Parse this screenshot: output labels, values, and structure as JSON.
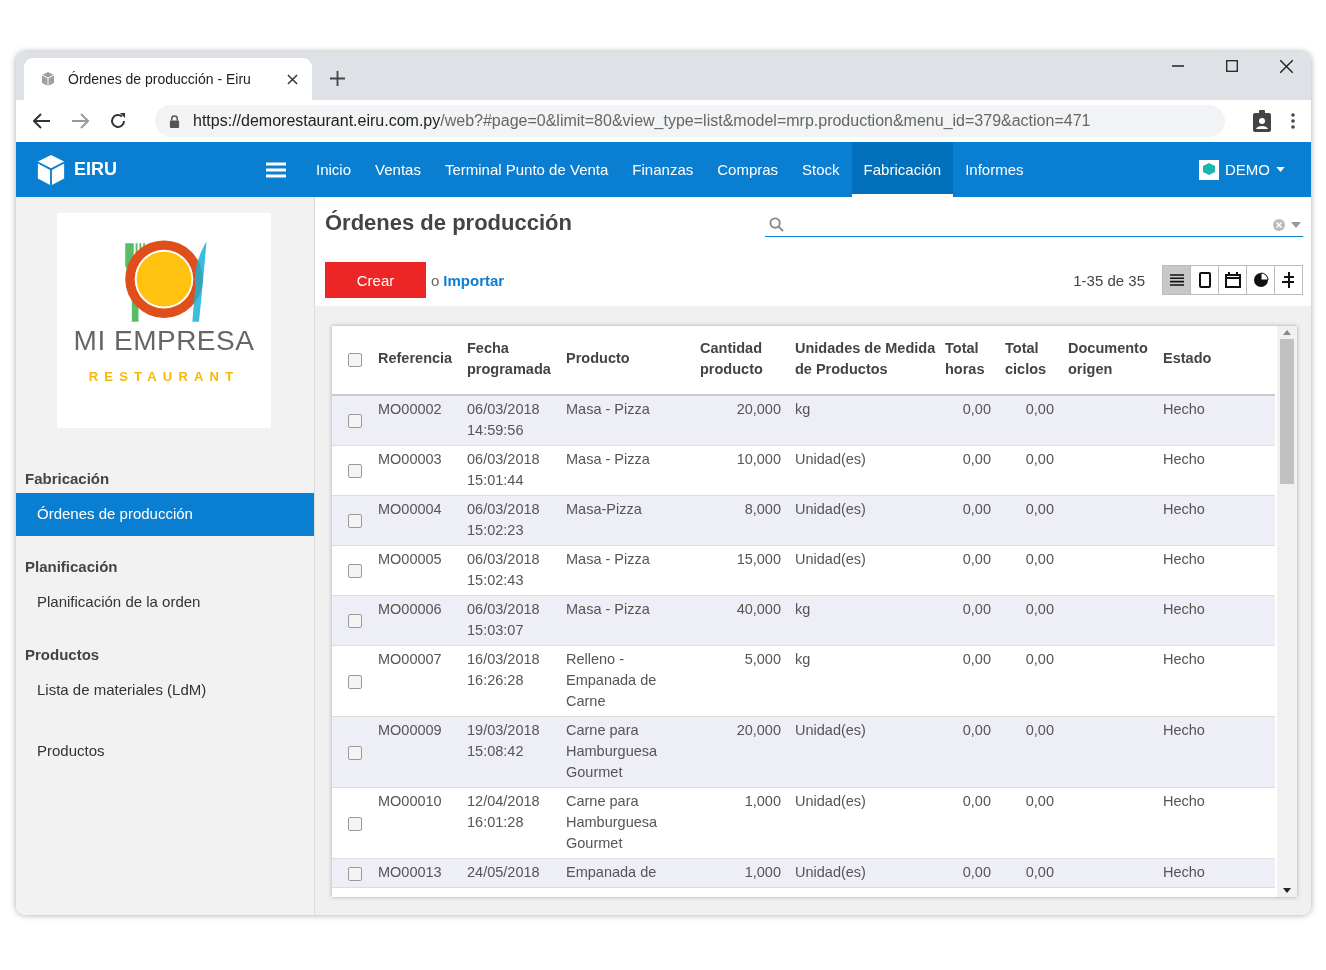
{
  "browser": {
    "tab_title": "Órdenes de producción - Eiru",
    "url_host": "https://demorestaurant.eiru.com.py",
    "url_path": "/web?#page=0&limit=80&view_type=list&model=mrp.production&menu_id=379&action=471"
  },
  "navbar": {
    "brand": "EIRU",
    "user": "DEMO",
    "menu": [
      {
        "label": "Inicio",
        "selected": false
      },
      {
        "label": "Ventas",
        "selected": false
      },
      {
        "label": "Terminal Punto de Venta",
        "selected": false
      },
      {
        "label": "Finanzas",
        "selected": false
      },
      {
        "label": "Compras",
        "selected": false
      },
      {
        "label": "Stock",
        "selected": false
      },
      {
        "label": "Fabricación",
        "selected": true
      },
      {
        "label": "Informes",
        "selected": false
      }
    ]
  },
  "sidebar": {
    "logo": {
      "name": "MI EMPRESA",
      "tagline": "RESTAURANT"
    },
    "sections": [
      {
        "title": "Fabricación",
        "items": [
          {
            "label": "Órdenes de producción",
            "selected": true
          }
        ]
      },
      {
        "title": "Planificación",
        "items": [
          {
            "label": "Planificación de la orden",
            "selected": false
          }
        ]
      },
      {
        "title": "Productos",
        "items": [
          {
            "label": "Lista de materiales (LdM)",
            "selected": false
          },
          {
            "label": "Productos",
            "selected": false
          }
        ]
      }
    ]
  },
  "page": {
    "title": "Órdenes de producción",
    "create_button": "Crear",
    "or_text": "o",
    "import_link": "Importar",
    "pager": "1-35 de 35",
    "views": [
      {
        "kind": "list",
        "selected": true
      },
      {
        "kind": "form",
        "selected": false
      },
      {
        "kind": "calendar",
        "selected": false
      },
      {
        "kind": "graph",
        "selected": false
      },
      {
        "kind": "gantt",
        "selected": false
      }
    ]
  },
  "table": {
    "all_selected": false,
    "columns": [
      {
        "label": "Referencia",
        "kind": "text"
      },
      {
        "label": "Fecha programada",
        "kind": "text"
      },
      {
        "label": "Producto",
        "kind": "text"
      },
      {
        "label": "Cantidad producto",
        "kind": "number"
      },
      {
        "label": "Unidades de Medida de Productos",
        "kind": "text"
      },
      {
        "label": "Total horas",
        "kind": "number"
      },
      {
        "label": "Total ciclos",
        "kind": "number"
      },
      {
        "label": "Documento origen",
        "kind": "blank"
      },
      {
        "label": "Estado",
        "kind": "text"
      }
    ],
    "rows": [
      {
        "selected": false,
        "cells": [
          "MO00002",
          "06/03/2018 14:59:56",
          "Masa - Pizza",
          "20,000",
          "kg",
          "0,00",
          "0,00",
          "Hecho"
        ]
      },
      {
        "selected": false,
        "cells": [
          "MO00003",
          "06/03/2018 15:01:44",
          "Masa - Pizza",
          "10,000",
          "Unidad(es)",
          "0,00",
          "0,00",
          "Hecho"
        ]
      },
      {
        "selected": false,
        "cells": [
          "MO00004",
          "06/03/2018 15:02:23",
          "Masa-Pizza",
          "8,000",
          "Unidad(es)",
          "0,00",
          "0,00",
          "Hecho"
        ]
      },
      {
        "selected": false,
        "cells": [
          "MO00005",
          "06/03/2018 15:02:43",
          "Masa - Pizza",
          "15,000",
          "Unidad(es)",
          "0,00",
          "0,00",
          "Hecho"
        ]
      },
      {
        "selected": false,
        "cells": [
          "MO00006",
          "06/03/2018 15:03:07",
          "Masa - Pizza",
          "40,000",
          "kg",
          "0,00",
          "0,00",
          "Hecho"
        ]
      },
      {
        "selected": false,
        "cells": [
          "MO00007",
          "16/03/2018 16:26:28",
          "Relleno - Empanada de Carne",
          "5,000",
          "kg",
          "0,00",
          "0,00",
          "Hecho"
        ]
      },
      {
        "selected": false,
        "cells": [
          "MO00009",
          "19/03/2018 15:08:42",
          "Carne para Hamburguesa Gourmet",
          "20,000",
          "Unidad(es)",
          "0,00",
          "0,00",
          "Hecho"
        ]
      },
      {
        "selected": false,
        "cells": [
          "MO00010",
          "12/04/2018 16:01:28",
          "Carne para Hamburguesa Gourmet",
          "1,000",
          "Unidad(es)",
          "0,00",
          "0,00",
          "Hecho"
        ]
      },
      {
        "selected": false,
        "cells": [
          "MO00013",
          "24/05/2018",
          "Empanada de",
          "1,000",
          "Unidad(es)",
          "0,00",
          "0,00",
          "Hecho"
        ]
      }
    ]
  }
}
